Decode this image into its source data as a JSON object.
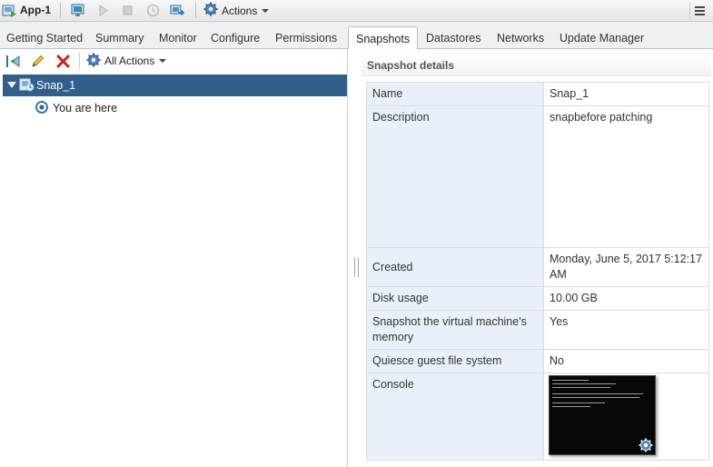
{
  "toolbar": {
    "vm_title": "App-1",
    "actions_label": "Actions"
  },
  "tabs": [
    {
      "label": "Getting Started"
    },
    {
      "label": "Summary"
    },
    {
      "label": "Monitor"
    },
    {
      "label": "Configure"
    },
    {
      "label": "Permissions"
    },
    {
      "label": "Snapshots",
      "active": true
    },
    {
      "label": "Datastores"
    },
    {
      "label": "Networks"
    },
    {
      "label": "Update Manager"
    }
  ],
  "left_panel": {
    "all_actions_label": "All Actions",
    "tree": {
      "snapshot_label": "Snap_1",
      "you_are_here": "You are here"
    }
  },
  "details": {
    "title": "Snapshot details",
    "rows": [
      {
        "key": "Name",
        "value": "Snap_1"
      },
      {
        "key": "Description",
        "value": "snapbefore patching"
      },
      {
        "key": "Created",
        "value": "Monday, June 5, 2017 5:12:17 AM"
      },
      {
        "key": "Disk usage",
        "value": "10.00 GB"
      },
      {
        "key": "Snapshot the virtual machine's memory",
        "value": "Yes"
      },
      {
        "key": "Quiesce guest file system",
        "value": "No"
      },
      {
        "key": "Console",
        "value": ""
      }
    ]
  },
  "colors": {
    "selection": "#2f5f8a",
    "key_cell_bg": "#e8f1fa",
    "tab_bar_bg": "#eef0f2"
  }
}
